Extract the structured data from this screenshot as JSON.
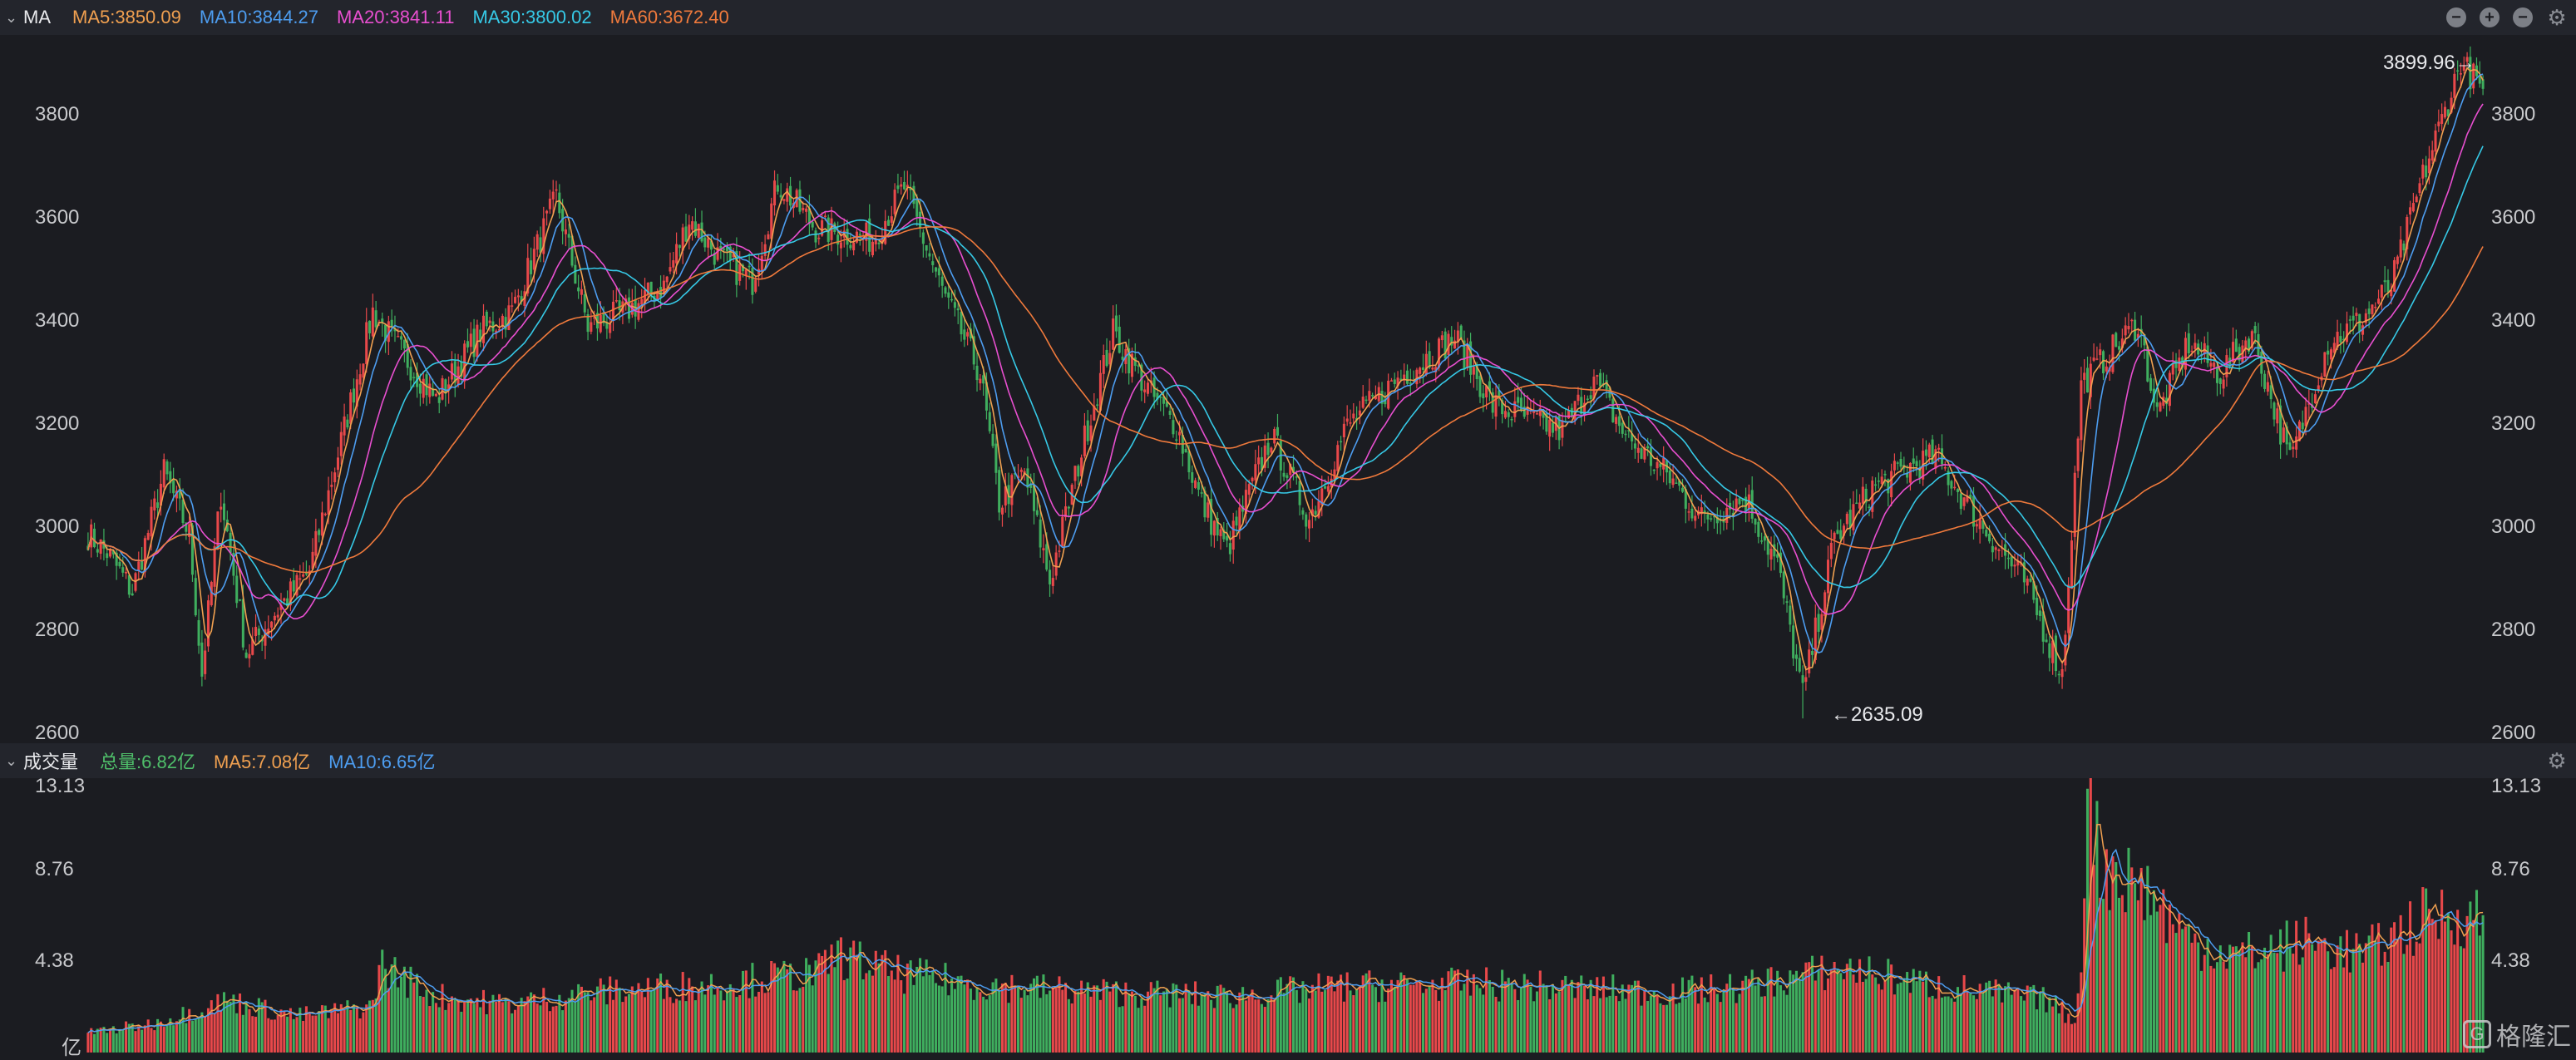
{
  "price_header": {
    "indicator": "MA",
    "legend": [
      {
        "text": "MA5:3850.09",
        "color": "#f0a050"
      },
      {
        "text": "MA10:3844.27",
        "color": "#4d9df0"
      },
      {
        "text": "MA20:3841.11",
        "color": "#e84fd0"
      },
      {
        "text": "MA30:3800.02",
        "color": "#36c9e6"
      },
      {
        "text": "MA60:3672.40",
        "color": "#f07a3c"
      }
    ],
    "controls": [
      "minus-circle-icon",
      "plus-circle-icon",
      "minus-circle-icon",
      "gear-icon"
    ]
  },
  "volume_header": {
    "indicator": "成交量",
    "legend": [
      {
        "text": "总量:6.82亿",
        "color": "#4fbf6a"
      },
      {
        "text": "MA5:7.08亿",
        "color": "#f0a050"
      },
      {
        "text": "MA10:6.65亿",
        "color": "#4d9df0"
      }
    ],
    "controls": [
      "gear-icon"
    ]
  },
  "price_axis": {
    "ticks": [
      "3800",
      "3600",
      "3400",
      "3200",
      "3000",
      "2800",
      "2600"
    ]
  },
  "volume_axis": {
    "ticks": [
      "13.13",
      "8.76",
      "4.38"
    ],
    "unit": "亿"
  },
  "annotations": {
    "high": "3899.96→",
    "low": "←2635.09"
  },
  "watermark": "格隆汇",
  "colors": {
    "up": "#e8484a",
    "down": "#3fae5e",
    "background": "#1b1c21",
    "header": "#23252c"
  },
  "chart_data": [
    {
      "type": "line",
      "title": "",
      "ylim": [
        2600,
        3950
      ],
      "ma_periods": [
        5,
        10,
        20,
        30,
        60
      ],
      "anchors_note": "",
      "price_path": [
        [
          0,
          2990
        ],
        [
          6,
          2955
        ],
        [
          14,
          2880
        ],
        [
          24,
          3110
        ],
        [
          32,
          2990
        ],
        [
          36,
          2720
        ],
        [
          42,
          3070
        ],
        [
          50,
          2760
        ],
        [
          58,
          2830
        ],
        [
          70,
          2920
        ],
        [
          90,
          3420
        ],
        [
          98,
          3350
        ],
        [
          110,
          3250
        ],
        [
          124,
          3380
        ],
        [
          134,
          3420
        ],
        [
          148,
          3640
        ],
        [
          158,
          3390
        ],
        [
          170,
          3420
        ],
        [
          182,
          3470
        ],
        [
          190,
          3600
        ],
        [
          200,
          3520
        ],
        [
          210,
          3480
        ],
        [
          218,
          3670
        ],
        [
          230,
          3580
        ],
        [
          248,
          3560
        ],
        [
          258,
          3660
        ],
        [
          270,
          3460
        ],
        [
          282,
          3300
        ],
        [
          288,
          3050
        ],
        [
          296,
          3110
        ],
        [
          304,
          2900
        ],
        [
          316,
          3200
        ],
        [
          324,
          3380
        ],
        [
          336,
          3260
        ],
        [
          344,
          3200
        ],
        [
          352,
          3050
        ],
        [
          360,
          2960
        ],
        [
          374,
          3180
        ],
        [
          386,
          3020
        ],
        [
          398,
          3200
        ],
        [
          414,
          3290
        ],
        [
          432,
          3370
        ],
        [
          444,
          3240
        ],
        [
          466,
          3190
        ],
        [
          476,
          3290
        ],
        [
          486,
          3180
        ],
        [
          500,
          3100
        ],
        [
          510,
          3020
        ],
        [
          524,
          3060
        ],
        [
          534,
          2930
        ],
        [
          542,
          2680
        ],
        [
          552,
          2980
        ],
        [
          564,
          3080
        ],
        [
          576,
          3120
        ],
        [
          584,
          3140
        ],
        [
          596,
          3030
        ],
        [
          612,
          2900
        ],
        [
          624,
          2720
        ],
        [
          630,
          3280
        ],
        [
          636,
          3320
        ],
        [
          648,
          3400
        ],
        [
          654,
          3220
        ],
        [
          664,
          3360
        ],
        [
          674,
          3300
        ],
        [
          684,
          3380
        ],
        [
          696,
          3130
        ],
        [
          708,
          3360
        ],
        [
          718,
          3400
        ],
        [
          728,
          3470
        ],
        [
          738,
          3680
        ],
        [
          750,
          3899.96
        ],
        [
          757,
          3850
        ]
      ],
      "high": 3899.96,
      "low": 2635.09
    },
    {
      "type": "bar",
      "title": "",
      "unit": "亿",
      "ylim": [
        0,
        13.13
      ],
      "total": 6.82,
      "ma5": 7.08,
      "ma10": 6.65,
      "volume_path": [
        [
          0,
          1.0
        ],
        [
          20,
          1.4
        ],
        [
          44,
          2.6
        ],
        [
          66,
          1.8
        ],
        [
          90,
          2.3
        ],
        [
          92,
          4.4
        ],
        [
          110,
          2.8
        ],
        [
          132,
          2.4
        ],
        [
          160,
          3.0
        ],
        [
          198,
          3.4
        ],
        [
          232,
          4.0
        ],
        [
          236,
          4.9
        ],
        [
          256,
          3.9
        ],
        [
          280,
          3.4
        ],
        [
          320,
          3.0
        ],
        [
          360,
          2.8
        ],
        [
          400,
          3.3
        ],
        [
          440,
          3.4
        ],
        [
          500,
          3.0
        ],
        [
          520,
          3.2
        ],
        [
          556,
          4.2
        ],
        [
          580,
          3.4
        ],
        [
          600,
          3.0
        ],
        [
          620,
          2.6
        ],
        [
          628,
          1.5
        ],
        [
          631,
          7.0
        ],
        [
          632,
          12.5
        ],
        [
          636,
          9.5
        ],
        [
          650,
          8.2
        ],
        [
          664,
          5.6
        ],
        [
          680,
          4.8
        ],
        [
          700,
          5.5
        ],
        [
          720,
          4.9
        ],
        [
          740,
          6.8
        ],
        [
          757,
          6.82
        ]
      ]
    }
  ]
}
